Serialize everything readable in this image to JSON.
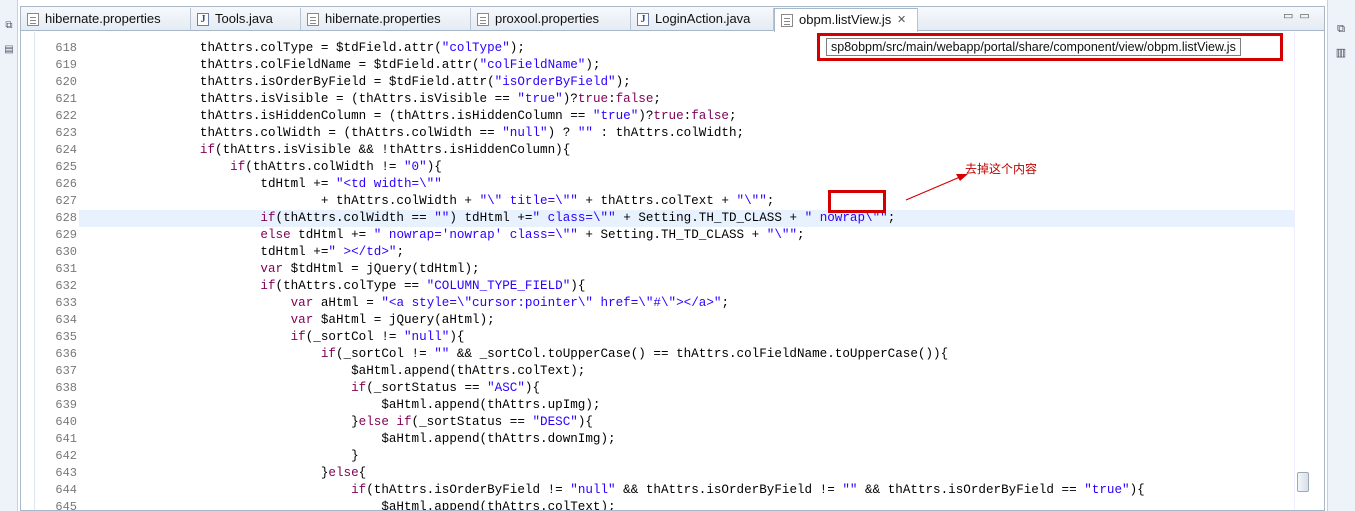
{
  "tabs": [
    {
      "label": "hibernate.properties",
      "icon": "properties-file-icon",
      "active": false
    },
    {
      "label": "Tools.java",
      "icon": "java-file-icon",
      "active": false
    },
    {
      "label": "hibernate.properties",
      "icon": "properties-file-icon",
      "active": false
    },
    {
      "label": "proxool.properties",
      "icon": "properties-file-icon",
      "active": false
    },
    {
      "label": "LoginAction.java",
      "icon": "java-file-icon",
      "active": false
    },
    {
      "label": "obpm.listView.js",
      "icon": "js-file-icon",
      "active": true
    }
  ],
  "tab_close_glyph": "✕",
  "tooltip_path": "sp8obpm/src/main/webapp/portal/share/component/view/obpm.listView.js",
  "annotation_text": "去掉这个内容",
  "colors": {
    "annotation_red": "#d40000",
    "keyword": "#7f0055",
    "string": "#2a00ff",
    "current_line": "#e8f2fe"
  },
  "current_line_number": "628",
  "code_lines": [
    {
      "n": "618",
      "segments": [
        [
          "t",
          "\t\t\t\tthAttrs.colType = $tdField.attr("
        ],
        [
          "s",
          "\"colType\""
        ],
        [
          "t",
          ");"
        ]
      ]
    },
    {
      "n": "619",
      "segments": [
        [
          "t",
          "\t\t\t\tthAttrs.colFieldName = $tdField.attr("
        ],
        [
          "s",
          "\"colFieldName\""
        ],
        [
          "t",
          ");"
        ]
      ]
    },
    {
      "n": "620",
      "segments": [
        [
          "t",
          "\t\t\t\tthAttrs.isOrderByField = $tdField.attr("
        ],
        [
          "s",
          "\"isOrderByField\""
        ],
        [
          "t",
          ");"
        ]
      ]
    },
    {
      "n": "621",
      "segments": [
        [
          "t",
          "\t\t\t\tthAttrs.isVisible = (thAttrs.isVisible == "
        ],
        [
          "s",
          "\"true\""
        ],
        [
          "t",
          ")?"
        ],
        [
          "k",
          "true"
        ],
        [
          "t",
          ":"
        ],
        [
          "k",
          "false"
        ],
        [
          "t",
          ";"
        ]
      ]
    },
    {
      "n": "622",
      "segments": [
        [
          "t",
          "\t\t\t\tthAttrs.isHiddenColumn = (thAttrs.isHiddenColumn == "
        ],
        [
          "s",
          "\"true\""
        ],
        [
          "t",
          ")?"
        ],
        [
          "k",
          "true"
        ],
        [
          "t",
          ":"
        ],
        [
          "k",
          "false"
        ],
        [
          "t",
          ";"
        ]
      ]
    },
    {
      "n": "623",
      "segments": [
        [
          "t",
          "\t\t\t\tthAttrs.colWidth = (thAttrs.colWidth == "
        ],
        [
          "s",
          "\"null\""
        ],
        [
          "t",
          ") ? "
        ],
        [
          "s",
          "\"\""
        ],
        [
          "t",
          " : thAttrs.colWidth;"
        ]
      ]
    },
    {
      "n": "624",
      "segments": [
        [
          "t",
          "\t\t\t\t"
        ],
        [
          "k",
          "if"
        ],
        [
          "t",
          "(thAttrs.isVisible && !thAttrs.isHiddenColumn){"
        ]
      ]
    },
    {
      "n": "625",
      "segments": [
        [
          "t",
          "\t\t\t\t\t"
        ],
        [
          "k",
          "if"
        ],
        [
          "t",
          "(thAttrs.colWidth != "
        ],
        [
          "s",
          "\"0\""
        ],
        [
          "t",
          "){"
        ]
      ]
    },
    {
      "n": "626",
      "segments": [
        [
          "t",
          "\t\t\t\t\t\ttdHtml += "
        ],
        [
          "s",
          "\"<td width=\\\"\""
        ]
      ]
    },
    {
      "n": "627",
      "segments": [
        [
          "t",
          "\t\t\t\t\t\t\t\t+ thAttrs.colWidth + "
        ],
        [
          "s",
          "\"\\\" title=\\\"\""
        ],
        [
          "t",
          " + thAttrs.colText + "
        ],
        [
          "s",
          "\"\\\"\""
        ],
        [
          "t",
          ";"
        ]
      ]
    },
    {
      "n": "628",
      "segments": [
        [
          "t",
          "\t\t\t\t\t\t"
        ],
        [
          "k",
          "if"
        ],
        [
          "t",
          "(thAttrs.colWidth == "
        ],
        [
          "s",
          "\"\""
        ],
        [
          "t",
          ") tdHtml +="
        ],
        [
          "s",
          "\" class=\\\"\""
        ],
        [
          "t",
          " + Setting.TH_TD_CLASS + "
        ],
        [
          "s",
          "\" nowrap\\\"\""
        ],
        [
          "t",
          ";"
        ]
      ]
    },
    {
      "n": "629",
      "segments": [
        [
          "t",
          "\t\t\t\t\t\t"
        ],
        [
          "k",
          "else"
        ],
        [
          "t",
          " tdHtml += "
        ],
        [
          "s",
          "\" nowrap='nowrap' class=\\\"\""
        ],
        [
          "t",
          " + Setting.TH_TD_CLASS + "
        ],
        [
          "s",
          "\"\\\"\""
        ],
        [
          "t",
          ";"
        ]
      ]
    },
    {
      "n": "630",
      "segments": [
        [
          "t",
          "\t\t\t\t\t\ttdHtml +="
        ],
        [
          "s",
          "\" ></td>\""
        ],
        [
          "t",
          ";"
        ]
      ]
    },
    {
      "n": "631",
      "segments": [
        [
          "t",
          "\t\t\t\t\t\t"
        ],
        [
          "k",
          "var"
        ],
        [
          "t",
          " $tdHtml = jQuery(tdHtml);"
        ]
      ]
    },
    {
      "n": "632",
      "segments": [
        [
          "t",
          "\t\t\t\t\t\t"
        ],
        [
          "k",
          "if"
        ],
        [
          "t",
          "(thAttrs.colType == "
        ],
        [
          "s",
          "\"COLUMN_TYPE_FIELD\""
        ],
        [
          "t",
          "){"
        ]
      ]
    },
    {
      "n": "633",
      "segments": [
        [
          "t",
          "\t\t\t\t\t\t\t"
        ],
        [
          "k",
          "var"
        ],
        [
          "t",
          " aHtml = "
        ],
        [
          "s",
          "\"<a style=\\\"cursor:pointer\\\" href=\\\"#\\\"></a>\""
        ],
        [
          "t",
          ";"
        ]
      ]
    },
    {
      "n": "634",
      "segments": [
        [
          "t",
          "\t\t\t\t\t\t\t"
        ],
        [
          "k",
          "var"
        ],
        [
          "t",
          " $aHtml = jQuery(aHtml);"
        ]
      ]
    },
    {
      "n": "635",
      "segments": [
        [
          "t",
          "\t\t\t\t\t\t\t"
        ],
        [
          "k",
          "if"
        ],
        [
          "t",
          "(_sortCol != "
        ],
        [
          "s",
          "\"null\""
        ],
        [
          "t",
          "){"
        ]
      ]
    },
    {
      "n": "636",
      "segments": [
        [
          "t",
          "\t\t\t\t\t\t\t\t"
        ],
        [
          "k",
          "if"
        ],
        [
          "t",
          "(_sortCol != "
        ],
        [
          "s",
          "\"\""
        ],
        [
          "t",
          " && _sortCol.toUpperCase() == thAttrs.colFieldName.toUpperCase()){"
        ]
      ]
    },
    {
      "n": "637",
      "segments": [
        [
          "t",
          "\t\t\t\t\t\t\t\t\t$aHtml.append(thAttrs.colText);"
        ]
      ]
    },
    {
      "n": "638",
      "segments": [
        [
          "t",
          "\t\t\t\t\t\t\t\t\t"
        ],
        [
          "k",
          "if"
        ],
        [
          "t",
          "(_sortStatus == "
        ],
        [
          "s",
          "\"ASC\""
        ],
        [
          "t",
          "){"
        ]
      ]
    },
    {
      "n": "639",
      "segments": [
        [
          "t",
          "\t\t\t\t\t\t\t\t\t\t$aHtml.append(thAttrs.upImg);"
        ]
      ]
    },
    {
      "n": "640",
      "segments": [
        [
          "t",
          "\t\t\t\t\t\t\t\t\t}"
        ],
        [
          "k",
          "else if"
        ],
        [
          "t",
          "(_sortStatus == "
        ],
        [
          "s",
          "\"DESC\""
        ],
        [
          "t",
          "){"
        ]
      ]
    },
    {
      "n": "641",
      "segments": [
        [
          "t",
          "\t\t\t\t\t\t\t\t\t\t$aHtml.append(thAttrs.downImg);"
        ]
      ]
    },
    {
      "n": "642",
      "segments": [
        [
          "t",
          "\t\t\t\t\t\t\t\t\t}"
        ]
      ]
    },
    {
      "n": "643",
      "segments": [
        [
          "t",
          "\t\t\t\t\t\t\t\t}"
        ],
        [
          "k",
          "else"
        ],
        [
          "t",
          "{"
        ]
      ]
    },
    {
      "n": "644",
      "segments": [
        [
          "t",
          "\t\t\t\t\t\t\t\t\t"
        ],
        [
          "k",
          "if"
        ],
        [
          "t",
          "(thAttrs.isOrderByField != "
        ],
        [
          "s",
          "\"null\""
        ],
        [
          "t",
          " && thAttrs.isOrderByField != "
        ],
        [
          "s",
          "\"\""
        ],
        [
          "t",
          " && thAttrs.isOrderByField == "
        ],
        [
          "s",
          "\"true\""
        ],
        [
          "t",
          "){"
        ]
      ]
    },
    {
      "n": "645",
      "segments": [
        [
          "t",
          "\t\t\t\t\t\t\t\t\t\t$aHtml.append(thAttrs.colText);"
        ]
      ]
    }
  ]
}
